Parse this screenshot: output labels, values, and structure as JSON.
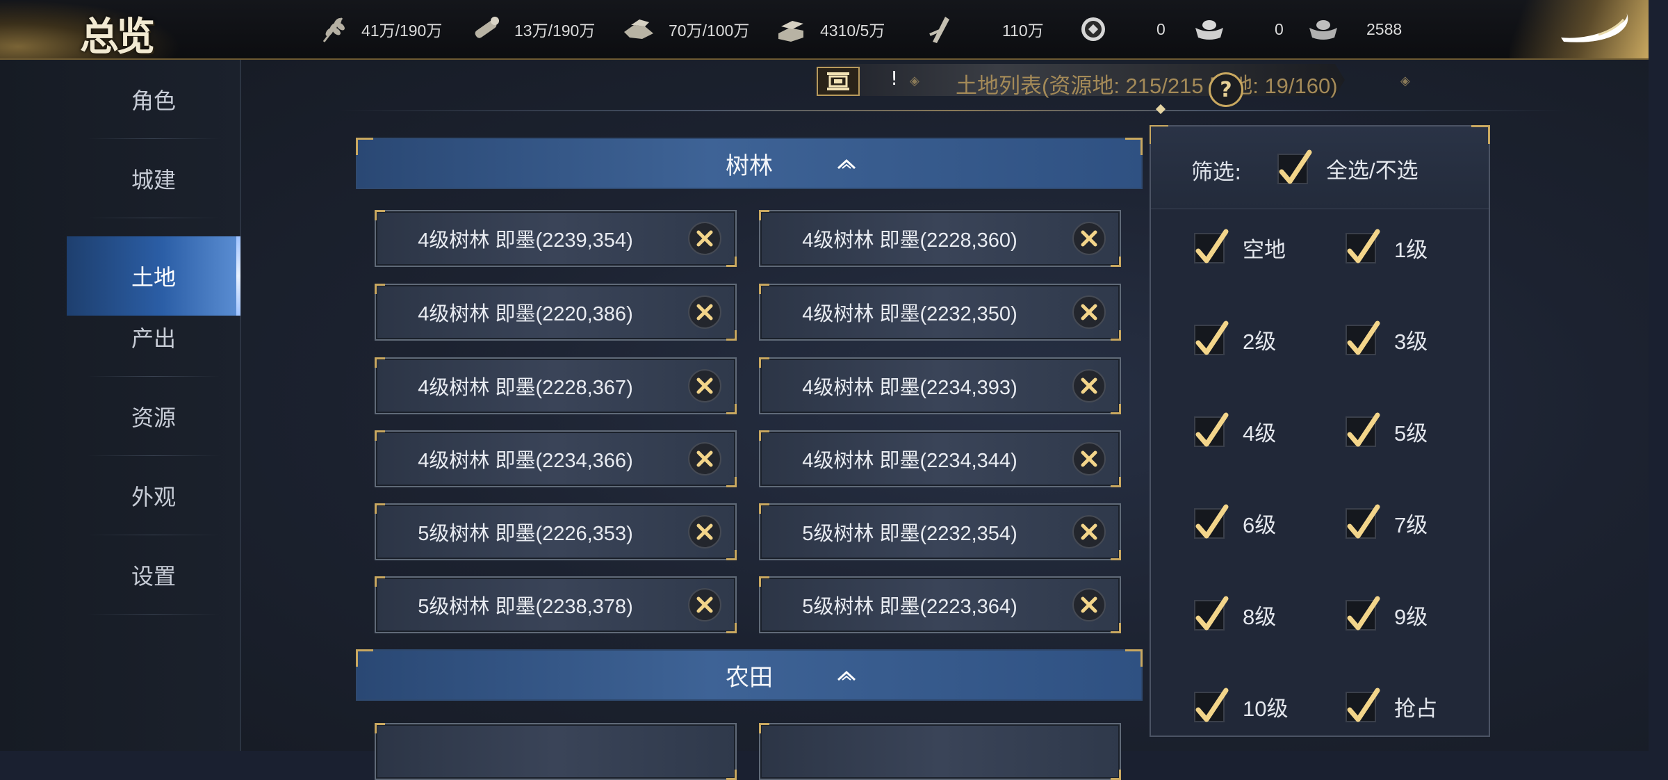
{
  "app": {
    "title": "总览"
  },
  "resources": [
    {
      "icon": "grain-icon",
      "value": "41万/190万"
    },
    {
      "icon": "wood-icon",
      "value": "13万/190万"
    },
    {
      "icon": "iron-icon",
      "value": "70万/100万"
    },
    {
      "icon": "stone-icon",
      "value": "4310/5万"
    },
    {
      "icon": "decree-icon",
      "value": "110万"
    },
    {
      "icon": "copper-coin-icon",
      "value": "0"
    },
    {
      "icon": "gold-ingot-icon",
      "value": "0"
    },
    {
      "icon": "silver-ingot-icon",
      "value": "2588"
    }
  ],
  "sidebar": {
    "items": [
      {
        "label": "角色",
        "active": false
      },
      {
        "label": "城建",
        "active": false
      },
      {
        "label": "土地",
        "active": true
      },
      {
        "label": "产出",
        "active": false
      },
      {
        "label": "资源",
        "active": false
      },
      {
        "label": "外观",
        "active": false
      },
      {
        "label": "设置",
        "active": false
      }
    ]
  },
  "header": {
    "exclaim": "!",
    "title": "土地列表(资源地: 215/215   空地: 19/160)",
    "help": "?"
  },
  "sections": [
    {
      "name": "树林",
      "lands": [
        "4级树林 即墨(2239,354)",
        "4级树林 即墨(2228,360)",
        "4级树林 即墨(2220,386)",
        "4级树林 即墨(2232,350)",
        "4级树林 即墨(2228,367)",
        "4级树林 即墨(2234,393)",
        "4级树林 即墨(2234,366)",
        "4级树林 即墨(2234,344)",
        "5级树林 即墨(2226,353)",
        "5级树林 即墨(2232,354)",
        "5级树林 即墨(2238,378)",
        "5级树林 即墨(2223,364)"
      ]
    },
    {
      "name": "农田",
      "lands": []
    }
  ],
  "filter": {
    "label": "筛选:",
    "select_all": {
      "label": "全选/不选",
      "checked": true
    },
    "options": [
      {
        "label": "空地",
        "checked": true
      },
      {
        "label": "1级",
        "checked": true
      },
      {
        "label": "2级",
        "checked": true
      },
      {
        "label": "3级",
        "checked": true
      },
      {
        "label": "4级",
        "checked": true
      },
      {
        "label": "5级",
        "checked": true
      },
      {
        "label": "6级",
        "checked": true
      },
      {
        "label": "7级",
        "checked": true
      },
      {
        "label": "8级",
        "checked": true
      },
      {
        "label": "9级",
        "checked": true
      },
      {
        "label": "10级",
        "checked": true
      },
      {
        "label": "抢占",
        "checked": true
      }
    ]
  },
  "colors": {
    "gold": "#c9a860",
    "active_tab": "#2b5ea6",
    "check": "#f3d58a"
  }
}
